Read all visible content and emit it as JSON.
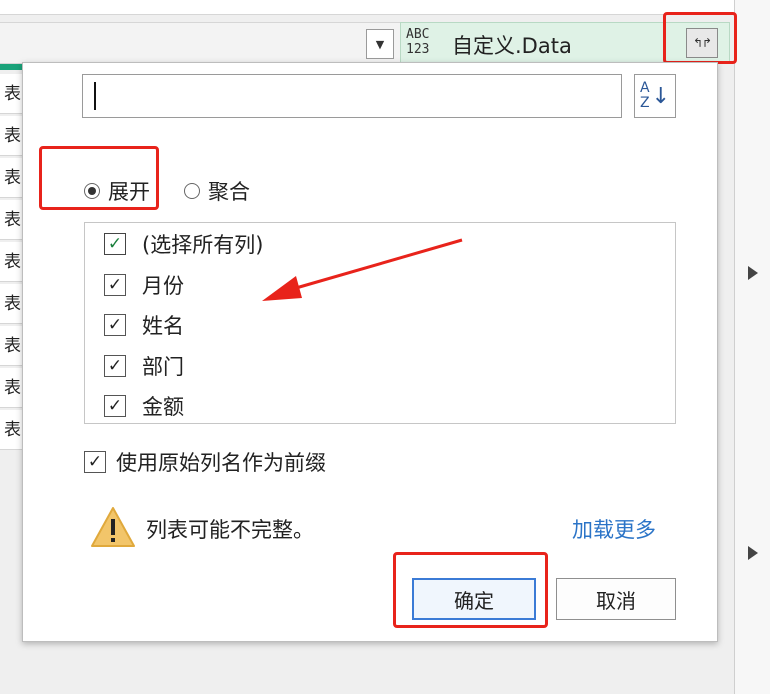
{
  "column_header": {
    "type_icon_top": "ABC",
    "type_icon_bottom": "123",
    "title": "自定义.Data"
  },
  "rows": [
    "表",
    "表",
    "表",
    "表",
    "表",
    "表",
    "表",
    "表",
    "表"
  ],
  "popup": {
    "search": {
      "value": "",
      "placeholder": ""
    },
    "sort_icon_top": "A",
    "sort_icon_bottom": "Z",
    "modes": [
      {
        "label": "展开",
        "selected": true
      },
      {
        "label": "聚合",
        "selected": false
      }
    ],
    "columns": [
      {
        "label": "(选择所有列)",
        "checked": true
      },
      {
        "label": "月份",
        "checked": true
      },
      {
        "label": "姓名",
        "checked": true
      },
      {
        "label": "部门",
        "checked": true
      },
      {
        "label": "金额",
        "checked": true
      }
    ],
    "use_prefix": {
      "label": "使用原始列名作为前缀",
      "checked": true
    },
    "warning": "列表可能不完整。",
    "load_more": "加载更多",
    "ok_label": "确定",
    "cancel_label": "取消"
  },
  "colors": {
    "annotation_red": "#e8231b",
    "header_green": "#dff2e6",
    "link_blue": "#2b74c7"
  }
}
